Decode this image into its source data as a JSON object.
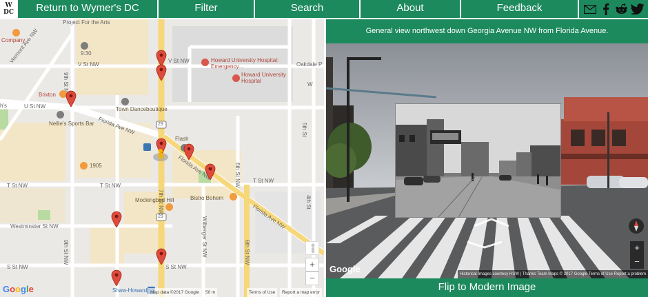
{
  "nav": {
    "logo_top": "W",
    "logo_bottom": "DC",
    "return_label": "Return to Wymer's DC",
    "filter_label": "Filter",
    "search_label": "Search",
    "about_label": "About",
    "feedback_label": "Feedback",
    "social_icons": [
      "email-icon",
      "facebook-icon",
      "reddit-icon",
      "twitter-icon"
    ]
  },
  "map": {
    "labels": {
      "project_for_arts": "Project For the Arts",
      "company": "Company",
      "vermont_ave": "Vermont Ave NW",
      "v_st_west": "V St NW",
      "v_st_east": "V St NW",
      "oakdale": "Oakdale P",
      "howard_hospital": "Howard University Hospital: Emergency...",
      "howard_univ_hospital_1": "Howard University",
      "howard_univ_hospital_2": "Hospital",
      "brixton": "Brixton",
      "u_st": "U St NW",
      "nellies": "Nellie's Sports Bar",
      "town_danceboutique": "Town Danceboutique",
      "florida_ave_west": "Florida Ave NW",
      "flash": "Flash",
      "florida_ave_mid": "Florida Ave NW",
      "florida_ave_east": "Florida Ave NW",
      "ninth_st_top": "9th St NW",
      "seventh_st": "7th St NW",
      "sixth_st": "6th St NW",
      "fifth_st": "5th St",
      "w_top": "W",
      "fourth_st": "4th St",
      "t_st_west": "T St NW",
      "t_st_east": "T St NW",
      "t_st_mid": "T St NW",
      "restaurant_1905": "1905",
      "mockingbird": "Mockingbird Hill",
      "bistro_bohem": "Bistro Bohem",
      "westminster": "Westminster St NW",
      "wilberger": "Wilberger St NW",
      "ninth_st_bottom": "9th St NW",
      "sixth_st_bottom": "6th St NW",
      "s_st_west": "S St NW",
      "s_st_east": "S St NW",
      "shaw_howard": "Shaw-Howard",
      "time_label": "9:30",
      "route_29_a": "29",
      "route_29_b": "29",
      "hs": "h's"
    },
    "pins_count": 10,
    "zoom_in": "+",
    "zoom_out": "−",
    "google": "Google",
    "footer_data": "Map data ©2017 Google",
    "footer_scale": "50 m",
    "footer_terms": "Terms of Use",
    "footer_report": "Report a map error"
  },
  "photo": {
    "caption": "General view northwest down Georgia Avenue NW from Florida Avenue.",
    "google": "Google",
    "footer": "Historical Images courtesy HSW | Thanks Team Maps  © 2017 Google   Terms of Use   Report a problem",
    "zoom_in": "+",
    "zoom_out": "−",
    "flip_label": "Flip to Modern Image"
  },
  "colors": {
    "brand_green": "#1d8a5e",
    "pin_red": "#dd4b3e",
    "arterial_yellow": "#f6d77a"
  }
}
